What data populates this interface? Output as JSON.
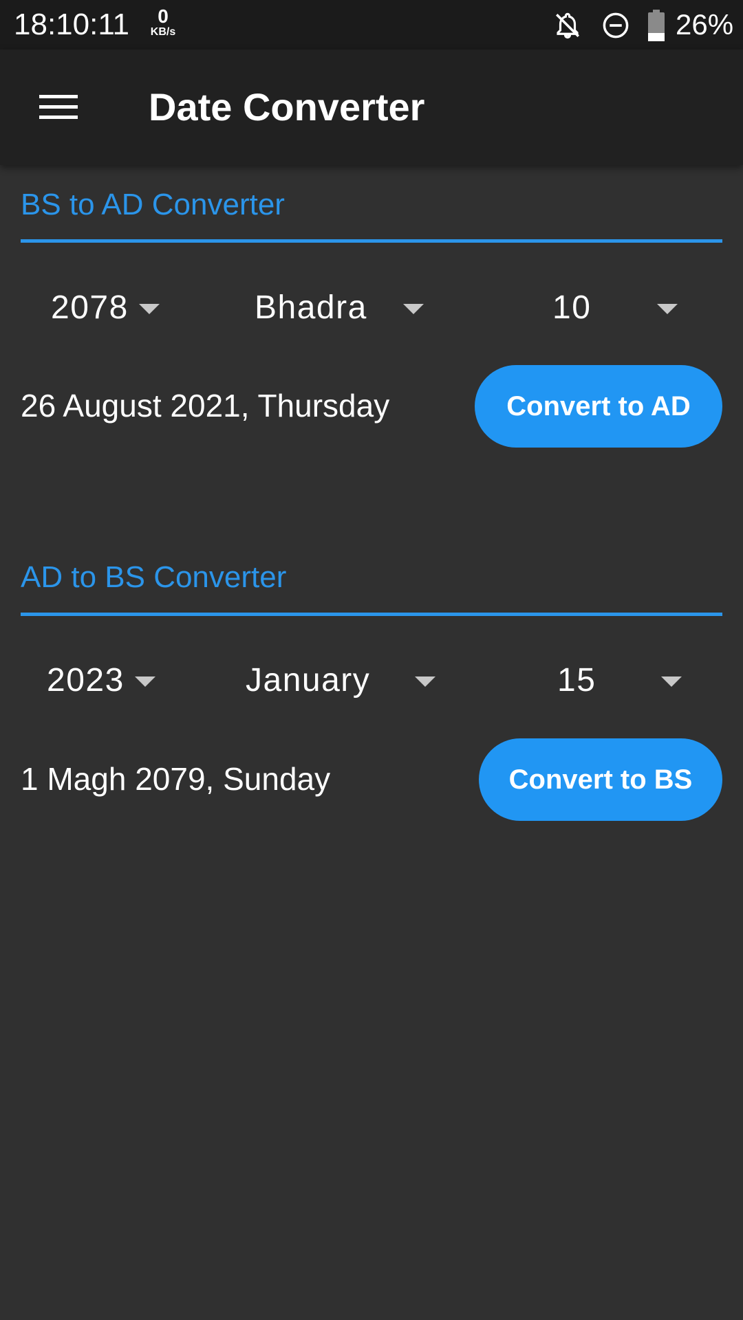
{
  "status_bar": {
    "time": "18:10:11",
    "net_speed_value": "0",
    "net_speed_unit": "KB/s",
    "icons": [
      "notifications-off-icon",
      "do-not-disturb-icon",
      "battery-icon"
    ],
    "battery_percent": "26%"
  },
  "app_bar": {
    "menu_icon": "hamburger-menu-icon",
    "title": "Date Converter"
  },
  "bs_to_ad": {
    "title": "BS to AD Converter",
    "year": "2078",
    "month": "Bhadra",
    "day": "10",
    "result": "26 August 2021, Thursday",
    "button_label": "Convert to AD"
  },
  "ad_to_bs": {
    "title": "AD to BS Converter",
    "year": "2023",
    "month": "January",
    "day": "15",
    "result": "1 Magh 2079, Sunday",
    "button_label": "Convert to BS"
  },
  "colors": {
    "accent": "#2196f3",
    "section_title": "#2b95ea",
    "background": "#303030",
    "app_bar": "#212121",
    "status_bar": "#1b1b1b"
  }
}
